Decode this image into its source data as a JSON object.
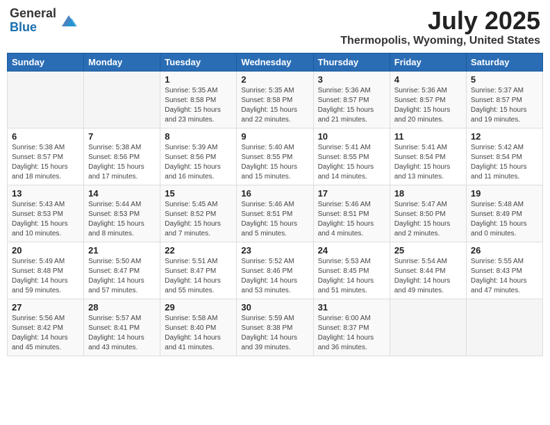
{
  "header": {
    "logo_general": "General",
    "logo_blue": "Blue",
    "title": "July 2025",
    "subtitle": "Thermopolis, Wyoming, United States"
  },
  "days_of_week": [
    "Sunday",
    "Monday",
    "Tuesday",
    "Wednesday",
    "Thursday",
    "Friday",
    "Saturday"
  ],
  "weeks": [
    [
      {
        "day": "",
        "info": ""
      },
      {
        "day": "",
        "info": ""
      },
      {
        "day": "1",
        "info": "Sunrise: 5:35 AM\nSunset: 8:58 PM\nDaylight: 15 hours\nand 23 minutes."
      },
      {
        "day": "2",
        "info": "Sunrise: 5:35 AM\nSunset: 8:58 PM\nDaylight: 15 hours\nand 22 minutes."
      },
      {
        "day": "3",
        "info": "Sunrise: 5:36 AM\nSunset: 8:57 PM\nDaylight: 15 hours\nand 21 minutes."
      },
      {
        "day": "4",
        "info": "Sunrise: 5:36 AM\nSunset: 8:57 PM\nDaylight: 15 hours\nand 20 minutes."
      },
      {
        "day": "5",
        "info": "Sunrise: 5:37 AM\nSunset: 8:57 PM\nDaylight: 15 hours\nand 19 minutes."
      }
    ],
    [
      {
        "day": "6",
        "info": "Sunrise: 5:38 AM\nSunset: 8:57 PM\nDaylight: 15 hours\nand 18 minutes."
      },
      {
        "day": "7",
        "info": "Sunrise: 5:38 AM\nSunset: 8:56 PM\nDaylight: 15 hours\nand 17 minutes."
      },
      {
        "day": "8",
        "info": "Sunrise: 5:39 AM\nSunset: 8:56 PM\nDaylight: 15 hours\nand 16 minutes."
      },
      {
        "day": "9",
        "info": "Sunrise: 5:40 AM\nSunset: 8:55 PM\nDaylight: 15 hours\nand 15 minutes."
      },
      {
        "day": "10",
        "info": "Sunrise: 5:41 AM\nSunset: 8:55 PM\nDaylight: 15 hours\nand 14 minutes."
      },
      {
        "day": "11",
        "info": "Sunrise: 5:41 AM\nSunset: 8:54 PM\nDaylight: 15 hours\nand 13 minutes."
      },
      {
        "day": "12",
        "info": "Sunrise: 5:42 AM\nSunset: 8:54 PM\nDaylight: 15 hours\nand 11 minutes."
      }
    ],
    [
      {
        "day": "13",
        "info": "Sunrise: 5:43 AM\nSunset: 8:53 PM\nDaylight: 15 hours\nand 10 minutes."
      },
      {
        "day": "14",
        "info": "Sunrise: 5:44 AM\nSunset: 8:53 PM\nDaylight: 15 hours\nand 8 minutes."
      },
      {
        "day": "15",
        "info": "Sunrise: 5:45 AM\nSunset: 8:52 PM\nDaylight: 15 hours\nand 7 minutes."
      },
      {
        "day": "16",
        "info": "Sunrise: 5:46 AM\nSunset: 8:51 PM\nDaylight: 15 hours\nand 5 minutes."
      },
      {
        "day": "17",
        "info": "Sunrise: 5:46 AM\nSunset: 8:51 PM\nDaylight: 15 hours\nand 4 minutes."
      },
      {
        "day": "18",
        "info": "Sunrise: 5:47 AM\nSunset: 8:50 PM\nDaylight: 15 hours\nand 2 minutes."
      },
      {
        "day": "19",
        "info": "Sunrise: 5:48 AM\nSunset: 8:49 PM\nDaylight: 15 hours\nand 0 minutes."
      }
    ],
    [
      {
        "day": "20",
        "info": "Sunrise: 5:49 AM\nSunset: 8:48 PM\nDaylight: 14 hours\nand 59 minutes."
      },
      {
        "day": "21",
        "info": "Sunrise: 5:50 AM\nSunset: 8:47 PM\nDaylight: 14 hours\nand 57 minutes."
      },
      {
        "day": "22",
        "info": "Sunrise: 5:51 AM\nSunset: 8:47 PM\nDaylight: 14 hours\nand 55 minutes."
      },
      {
        "day": "23",
        "info": "Sunrise: 5:52 AM\nSunset: 8:46 PM\nDaylight: 14 hours\nand 53 minutes."
      },
      {
        "day": "24",
        "info": "Sunrise: 5:53 AM\nSunset: 8:45 PM\nDaylight: 14 hours\nand 51 minutes."
      },
      {
        "day": "25",
        "info": "Sunrise: 5:54 AM\nSunset: 8:44 PM\nDaylight: 14 hours\nand 49 minutes."
      },
      {
        "day": "26",
        "info": "Sunrise: 5:55 AM\nSunset: 8:43 PM\nDaylight: 14 hours\nand 47 minutes."
      }
    ],
    [
      {
        "day": "27",
        "info": "Sunrise: 5:56 AM\nSunset: 8:42 PM\nDaylight: 14 hours\nand 45 minutes."
      },
      {
        "day": "28",
        "info": "Sunrise: 5:57 AM\nSunset: 8:41 PM\nDaylight: 14 hours\nand 43 minutes."
      },
      {
        "day": "29",
        "info": "Sunrise: 5:58 AM\nSunset: 8:40 PM\nDaylight: 14 hours\nand 41 minutes."
      },
      {
        "day": "30",
        "info": "Sunrise: 5:59 AM\nSunset: 8:38 PM\nDaylight: 14 hours\nand 39 minutes."
      },
      {
        "day": "31",
        "info": "Sunrise: 6:00 AM\nSunset: 8:37 PM\nDaylight: 14 hours\nand 36 minutes."
      },
      {
        "day": "",
        "info": ""
      },
      {
        "day": "",
        "info": ""
      }
    ]
  ]
}
